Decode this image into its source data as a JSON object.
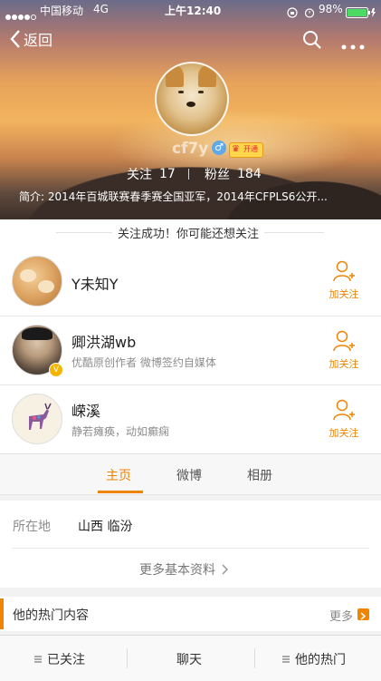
{
  "status_bar": {
    "carrier": "中国移动",
    "network": "4G",
    "time": "上午12:40",
    "battery": "98%"
  },
  "nav": {
    "back_label": "返回",
    "search_icon": "search-icon",
    "more_icon": "more-icon"
  },
  "profile": {
    "name": "cf7y",
    "badge_text": "开通",
    "follow_label": "关注",
    "follow_count": "17",
    "fans_label": "粉丝",
    "fans_count": "184",
    "bio": "简介: 2014年百城联赛春季赛全国亚军，2014年CFPLS6公开..."
  },
  "follow_success": {
    "text": "关注成功！你可能还想关注"
  },
  "recommendations": [
    {
      "name": "Y未知Y",
      "desc": "",
      "follow": "加关注"
    },
    {
      "name": "卿洪湖wb",
      "desc": "优酷原创作者 微博签约自媒体",
      "follow": "加关注"
    },
    {
      "name": "嵘溪",
      "desc": "静若瘫痪，动如癫痫",
      "follow": "加关注"
    }
  ],
  "tabs": [
    "主页",
    "微博",
    "相册"
  ],
  "info": {
    "location_label": "所在地",
    "location_value": "山西 临汾",
    "more_info": "更多基本资料"
  },
  "hot": {
    "title": "他的热门内容",
    "more": "更多"
  },
  "bottom_bar": {
    "followed": "已关注",
    "chat": "聊天",
    "hot": "他的热门"
  },
  "colors": {
    "accent": "#f08300"
  }
}
